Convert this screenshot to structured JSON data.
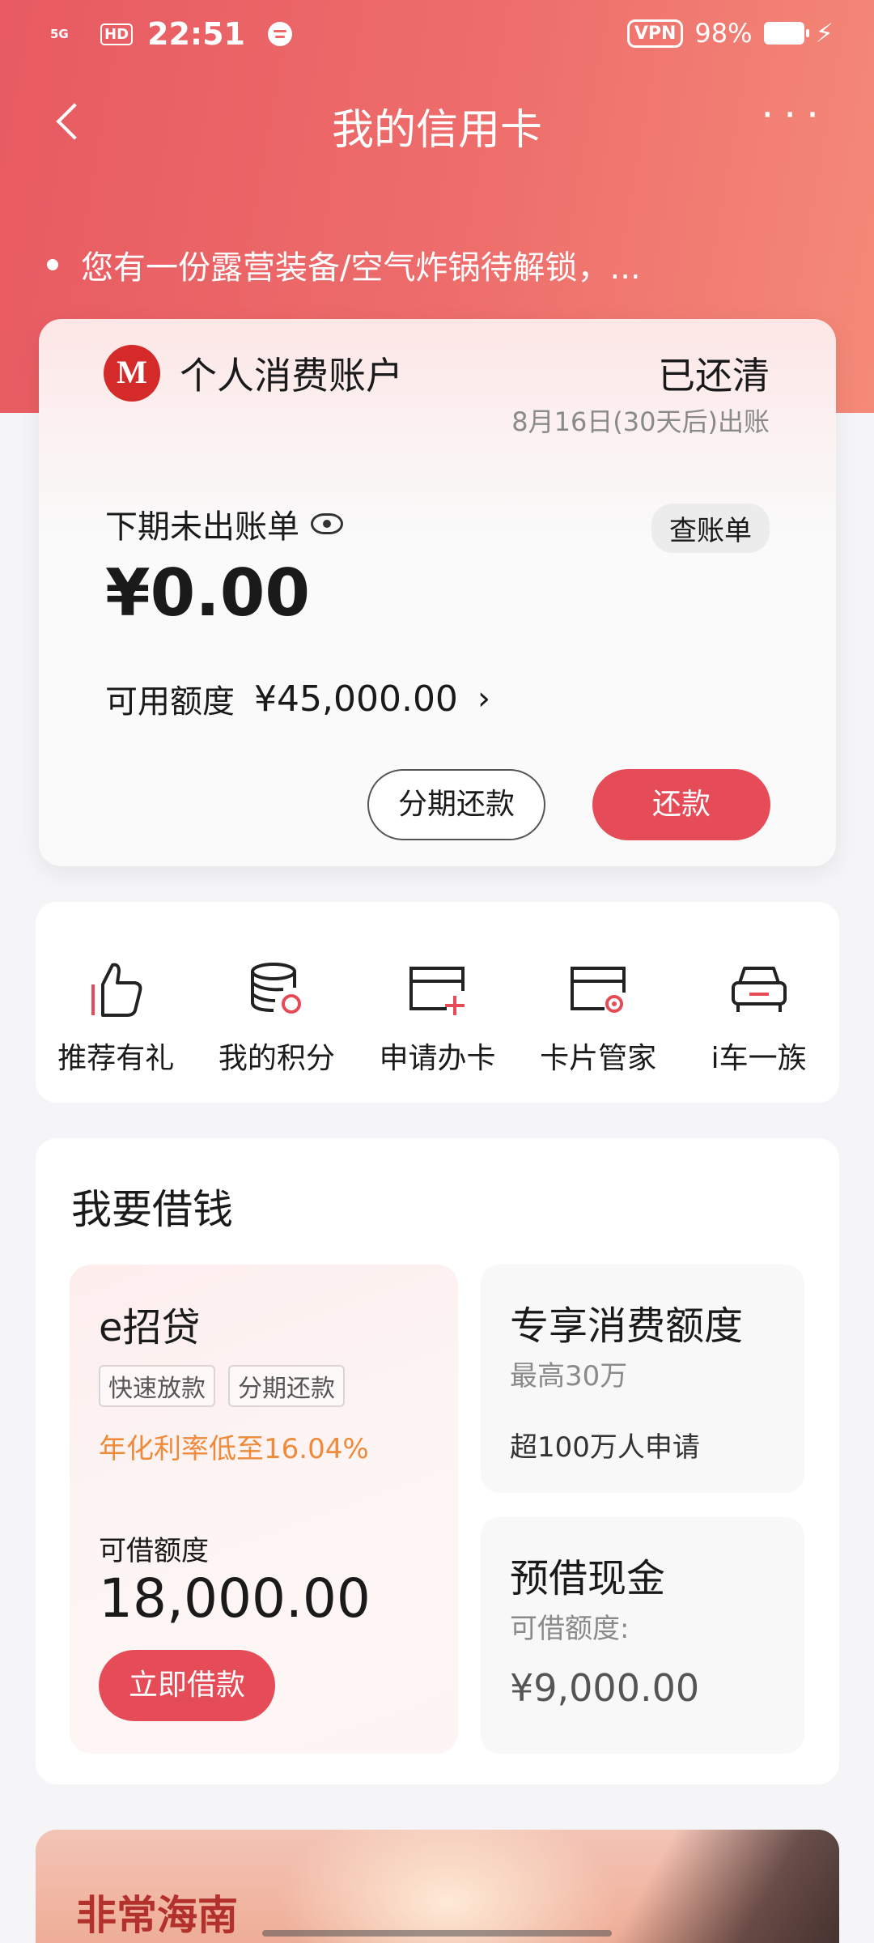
{
  "status_bar": {
    "network": "5G",
    "hd": "HD",
    "time": "22:51",
    "vpn": "VPN",
    "battery": "98%"
  },
  "nav": {
    "title": "我的信用卡"
  },
  "notice": {
    "text": "您有一份露营装备/空气炸锅待解锁，..."
  },
  "account_card": {
    "account_name": "个人消费账户",
    "status": "已还清",
    "bill_date": "8月16日(30天后)出账",
    "unbilled_label": "下期未出账单",
    "view_bill": "查账单",
    "amount": "¥0.00",
    "credit_label": "可用额度",
    "credit_value": "¥45,000.00",
    "installment_button": "分期还款",
    "repay_button": "还款"
  },
  "shortcuts": [
    {
      "label": "推荐有礼",
      "icon": "thumbs-up-icon"
    },
    {
      "label": "我的积分",
      "icon": "points-coin-icon"
    },
    {
      "label": "申请办卡",
      "icon": "card-add-icon"
    },
    {
      "label": "卡片管家",
      "icon": "card-settings-icon"
    },
    {
      "label": "i车一族",
      "icon": "car-icon"
    }
  ],
  "borrow": {
    "title": "我要借钱",
    "loan": {
      "name": "e招贷",
      "tags": [
        "快速放款",
        "分期还款"
      ],
      "rate": "年化利率低至16.04%",
      "limit_label": "可借额度",
      "limit": "18,000.00",
      "button": "立即借款"
    },
    "consumption": {
      "title": "专享消费额度",
      "sub": "最高30万",
      "foot": "超100万人申请"
    },
    "cash": {
      "title": "预借现金",
      "label": "可借额度:",
      "amount": "¥9,000.00"
    }
  },
  "banner": {
    "title": "非常海南"
  },
  "colors": {
    "brand_red": "#e64b58",
    "header_gradient_start": "#e75a61",
    "header_gradient_end": "#f48a78",
    "rate_orange": "#ef8a3a"
  }
}
